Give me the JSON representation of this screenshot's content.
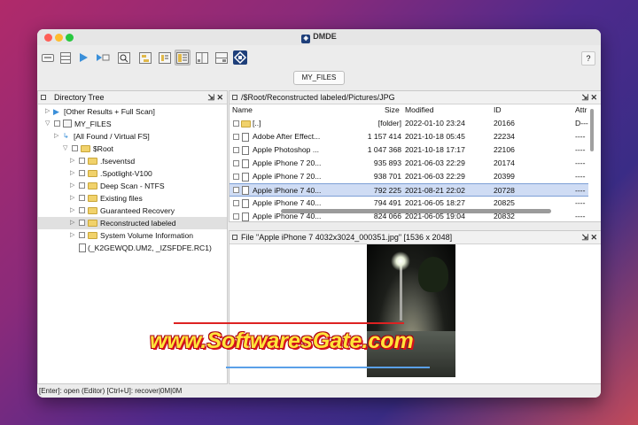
{
  "app": {
    "title": "DMDE"
  },
  "toolbar": {
    "buttons": [
      {
        "icon": "open-drive-icon"
      },
      {
        "icon": "partitions-icon"
      },
      {
        "icon": "play-icon"
      },
      {
        "icon": "goto-icon"
      },
      {
        "icon": "find-icon"
      },
      {
        "icon": "tree-icon"
      },
      {
        "icon": "list-view-icon"
      },
      {
        "icon": "cluster-map-icon"
      },
      {
        "icon": "split-view-icon"
      },
      {
        "icon": "recover-icon"
      }
    ],
    "help_label": "?"
  },
  "tab": {
    "label": "MY_FILES"
  },
  "directory_tree": {
    "title": "Directory Tree",
    "pin_icon": "pin-icon",
    "close_label": "✕",
    "items": [
      {
        "label": "[Other Results + Full Scan]"
      },
      {
        "label": "MY_FILES"
      },
      {
        "label": "[All Found / Virtual FS]"
      },
      {
        "label": "$Root"
      },
      {
        "label": ".fseventsd"
      },
      {
        "label": ".Spotlight-V100"
      },
      {
        "label": "Deep Scan - NTFS"
      },
      {
        "label": "Existing files"
      },
      {
        "label": "Guaranteed Recovery"
      },
      {
        "label": "Reconstructed labeled"
      },
      {
        "label": "System Volume Information"
      },
      {
        "label": "(_K2GEWQD.UM2, _IZSFDFE.RC1)"
      }
    ]
  },
  "file_list": {
    "path": "/$Root/Reconstructed labeled/Pictures/JPG",
    "close_label": "✕",
    "columns": {
      "name": "Name",
      "size": "Size",
      "modified": "Modified",
      "id": "ID",
      "attr": "Attr"
    },
    "rows": [
      {
        "name": "[..]",
        "size": "[folder]",
        "modified": "2022-01-10 23:24",
        "id": "20166",
        "attr": "D---"
      },
      {
        "name": "Adobe After Effect...",
        "size": "1 157 414",
        "modified": "2021-10-18 05:45",
        "id": "22234",
        "attr": "----"
      },
      {
        "name": "Apple Photoshop ...",
        "size": "1 047 368",
        "modified": "2021-10-18 17:17",
        "id": "22106",
        "attr": "----"
      },
      {
        "name": "Apple iPhone 7 20...",
        "size": "935 893",
        "modified": "2021-06-03 22:29",
        "id": "20174",
        "attr": "----"
      },
      {
        "name": "Apple iPhone 7 20...",
        "size": "938 701",
        "modified": "2021-06-03 22:29",
        "id": "20399",
        "attr": "----"
      },
      {
        "name": "Apple iPhone 7 40...",
        "size": "792 225",
        "modified": "2021-08-21 22:02",
        "id": "20728",
        "attr": "----"
      },
      {
        "name": "Apple iPhone 7 40...",
        "size": "794 491",
        "modified": "2021-06-05 18:27",
        "id": "20825",
        "attr": "----"
      },
      {
        "name": "Apple iPhone 7 40...",
        "size": "824 066",
        "modified": "2021-06-05 19:04",
        "id": "20832",
        "attr": "----"
      }
    ]
  },
  "preview": {
    "title": "File \"Apple iPhone 7 4032x3024_000351.jpg\" [1536 x 2048]",
    "close_label": "✕"
  },
  "statusbar": {
    "text": "[Enter]: open (Editor)  [Ctrl+U]: recover|0M|0M"
  },
  "watermark": {
    "text": "www.SoftwaresGate.com"
  }
}
